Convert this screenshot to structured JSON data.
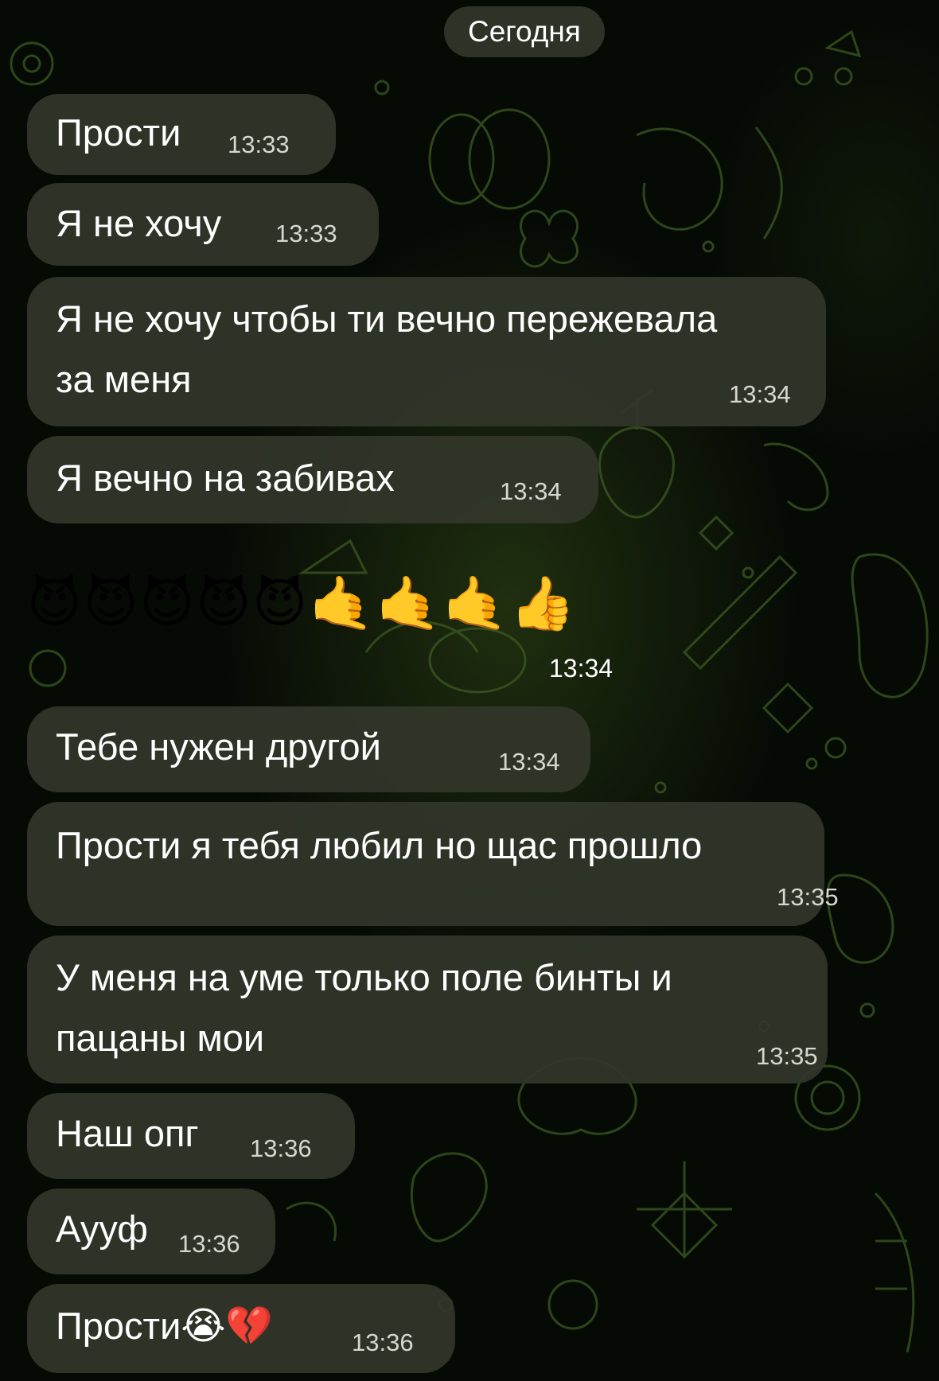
{
  "chat": {
    "date_label": "Сегодня",
    "messages": [
      {
        "text": "Прости",
        "time": "13:33"
      },
      {
        "text": "Я не хочу",
        "time": "13:33"
      },
      {
        "line1": "Я не хочу чтобы ти вечно пережевала",
        "line2": "за меня",
        "time": "13:34"
      },
      {
        "text": "Я вечно на забивах",
        "time": "13:34"
      },
      {
        "emojis": "😈😈😈😈😈🤙🤙🤙👍",
        "time": "13:34"
      },
      {
        "text": "Тебе нужен другой",
        "time": "13:34"
      },
      {
        "text": "Прости я тебя любил но щас прошло",
        "time": "13:35"
      },
      {
        "line1": "У меня на уме только поле бинты и",
        "line2": "пацаны мои",
        "time": "13:35"
      },
      {
        "text": "Наш опг",
        "time": "13:36"
      },
      {
        "text": "Аууф",
        "time": "13:36"
      },
      {
        "text": "Прости",
        "emojis": "😭💔",
        "time": "13:36"
      }
    ]
  },
  "colors": {
    "bubble": "#32362a",
    "background": "#060a05",
    "doodle_stroke": "#3c5a22",
    "text": "#ffffff",
    "time": "#d6d8cf"
  }
}
